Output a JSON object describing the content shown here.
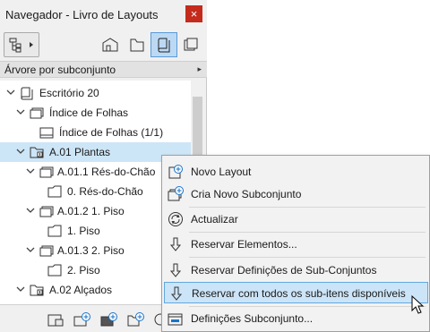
{
  "window": {
    "title": "Navegador - Livro de Layouts",
    "close_glyph": "×"
  },
  "toolbar": {
    "buttons": [
      "project-map-icon",
      "view-map-icon",
      "layout-book-icon",
      "publisher-sets-icon"
    ],
    "active": "layout-book-icon"
  },
  "selector": {
    "label": "Árvore por subconjunto",
    "arrow": "▸"
  },
  "tree": {
    "rows": [
      {
        "label": "Escritório 20",
        "expanded": true,
        "icon": "layout-book-icon"
      },
      {
        "label": "Índice de Folhas",
        "expanded": true,
        "icon": "subset-icon"
      },
      {
        "label": "Índice de Folhas (1/1)",
        "icon": "layout-icon"
      },
      {
        "label": "A.01 Plantas",
        "expanded": true,
        "icon": "subset-folder-icon",
        "selected": true
      },
      {
        "label": "A.01.1 Rés-do-Chão",
        "expanded": true,
        "icon": "subset-icon"
      },
      {
        "label": "0. Rés-do-Chão",
        "icon": "layout-icon"
      },
      {
        "label": "A.01.2 1. Piso",
        "expanded": true,
        "icon": "subset-icon"
      },
      {
        "label": "1. Piso",
        "icon": "layout-icon"
      },
      {
        "label": "A.01.3 2. Piso",
        "expanded": true,
        "icon": "subset-icon"
      },
      {
        "label": "2. Piso",
        "icon": "layout-icon"
      },
      {
        "label": "A.02 Alçados",
        "expanded": true,
        "icon": "subset-folder-icon"
      }
    ]
  },
  "bottombar": {
    "buttons": [
      "new-layout-icon",
      "new-subset-icon",
      "new-master-icon",
      "new-folder-icon",
      "settings-icon"
    ]
  },
  "context_menu": {
    "items": [
      {
        "label": "Novo Layout",
        "icon": "new-layout-icon"
      },
      {
        "label": "Cria Novo Subconjunto",
        "icon": "new-subset-icon"
      },
      {
        "label": "Actualizar",
        "icon": "refresh-icon"
      },
      {
        "label": "Reservar Elementos...",
        "icon": "reserve-arrow-icon"
      },
      {
        "label": "Reservar Definições de Sub-Conjuntos",
        "icon": "reserve-arrow-icon"
      },
      {
        "label": "Reservar com todos os sub-itens disponíveis",
        "icon": "reserve-arrow-icon",
        "highlighted": true
      },
      {
        "label": "Definições Subconjunto...",
        "icon": "subset-settings-icon"
      }
    ]
  },
  "colors": {
    "selection": "#cde6f7",
    "menu_highlight": "#cce4f7",
    "close_button": "#c42b1c",
    "accent_blue": "#1a73c8"
  }
}
